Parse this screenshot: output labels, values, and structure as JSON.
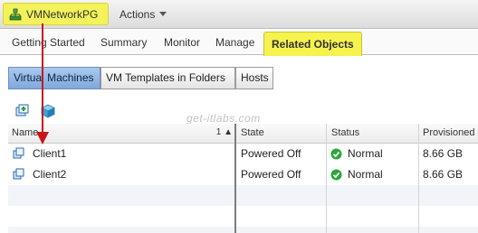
{
  "header": {
    "object_name": "VMNetworkPG",
    "actions_label": "Actions",
    "icon": "network-portgroup-icon"
  },
  "tabs": [
    {
      "label": "Getting Started"
    },
    {
      "label": "Summary"
    },
    {
      "label": "Monitor"
    },
    {
      "label": "Manage"
    },
    {
      "label": "Related Objects",
      "active": true
    }
  ],
  "subtabs": [
    {
      "label": "Virtual Machines",
      "active": true
    },
    {
      "label": "VM Templates in Folders"
    },
    {
      "label": "Hosts"
    }
  ],
  "toolbar": {
    "icons": [
      "new-vm-icon",
      "vm-cube-icon"
    ]
  },
  "watermark": "get-itlabs.com",
  "table": {
    "columns": [
      "Name",
      "State",
      "Status",
      "Provisioned S"
    ],
    "sort": {
      "column": "Name",
      "indicator": "1 ▲"
    },
    "rows": [
      {
        "name": "Client1",
        "state": "Powered Off",
        "status": "Normal",
        "provisioned": "8.66  GB"
      },
      {
        "name": "Client2",
        "state": "Powered Off",
        "status": "Normal",
        "provisioned": "8.66  GB"
      }
    ]
  },
  "colors": {
    "highlight": "#f6f24e",
    "selected_subtab": "#8fb4e2",
    "annotation_arrow": "#c8161d",
    "status_ok": "#2aa838"
  }
}
